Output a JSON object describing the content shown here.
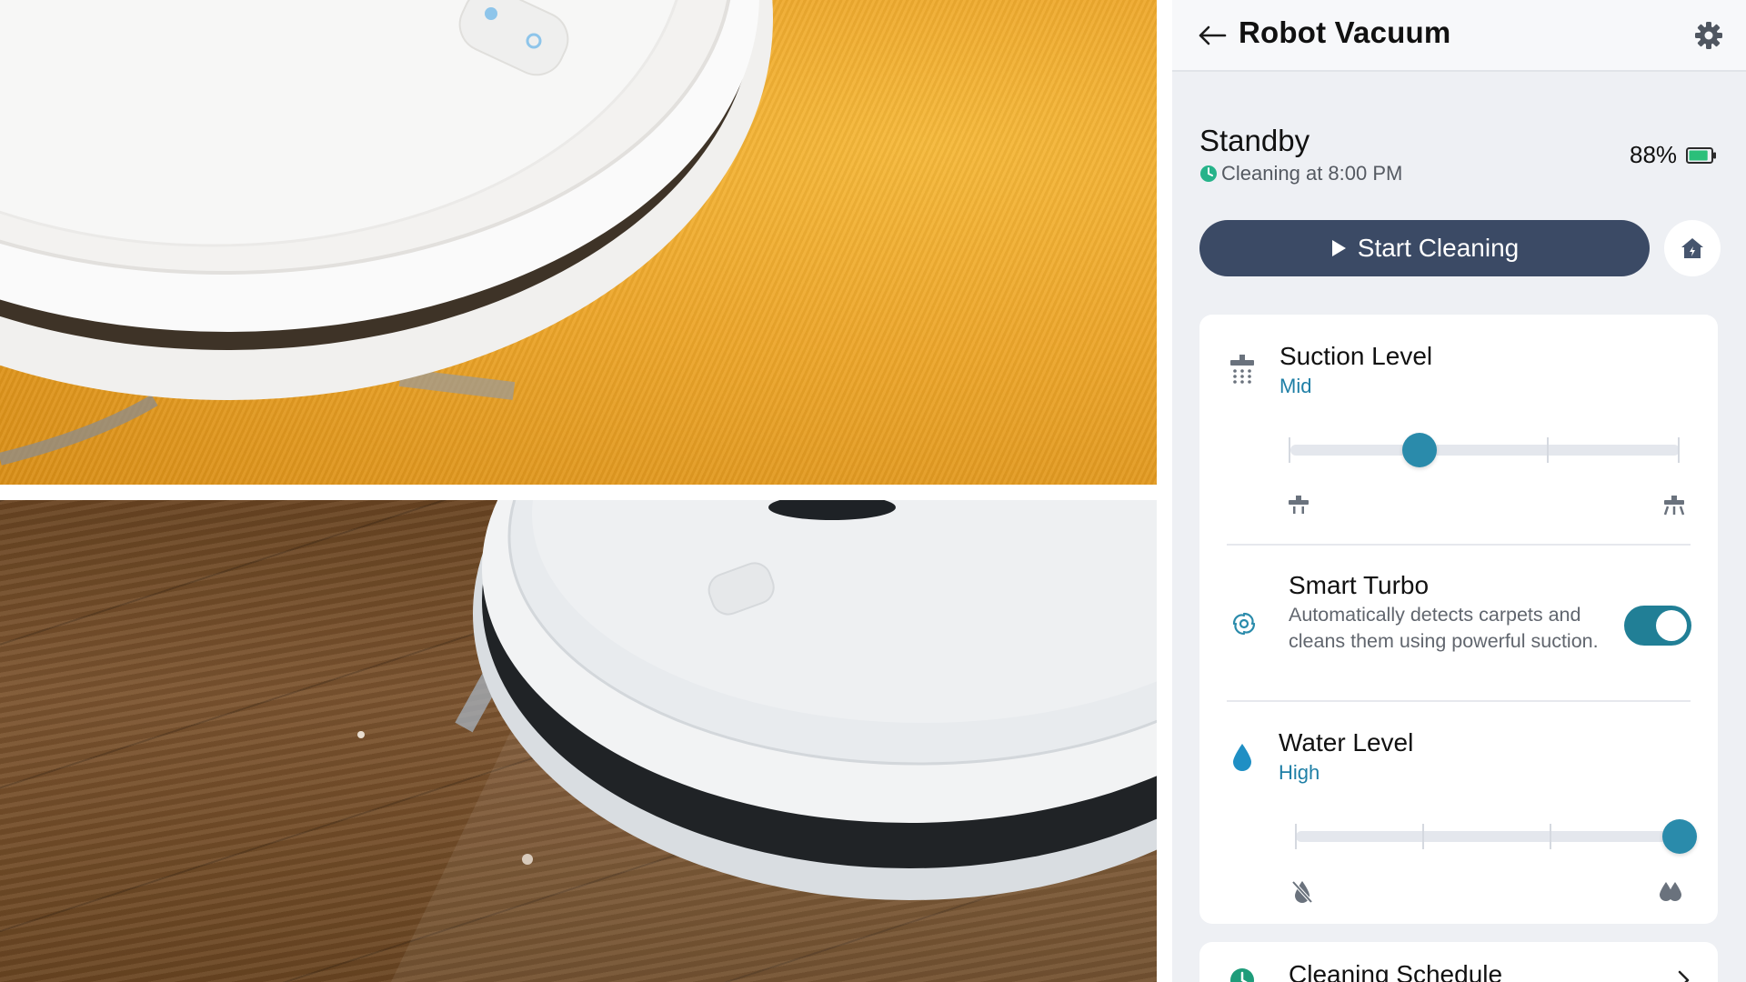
{
  "header": {
    "title": "Robot Vacuum",
    "back_icon": "back-arrow-icon",
    "settings_icon": "gear-icon"
  },
  "status": {
    "state": "Standby",
    "schedule_text": "Cleaning at 8:00 PM",
    "battery_percent": "88%",
    "battery_level": 0.88
  },
  "actions": {
    "start_label": "Start Cleaning",
    "dock_icon": "home-charge-icon"
  },
  "suction": {
    "title": "Suction Level",
    "value": "Mid",
    "level_index": 1,
    "level_count": 4
  },
  "smart_turbo": {
    "title": "Smart Turbo",
    "description": "Automatically detects carpets and cleans them using powerful suction.",
    "enabled": true
  },
  "water": {
    "title": "Water Level",
    "value": "High",
    "level_index": 3,
    "level_count": 4
  },
  "schedule_card": {
    "title": "Cleaning Schedule"
  },
  "colors": {
    "primary_button": "#3b4a65",
    "accent": "#2a8bab",
    "value_text": "#1f7fa6",
    "toggle_on": "#217f96",
    "panel_bg": "#eef0f4",
    "battery_green": "#2bbf7a"
  }
}
